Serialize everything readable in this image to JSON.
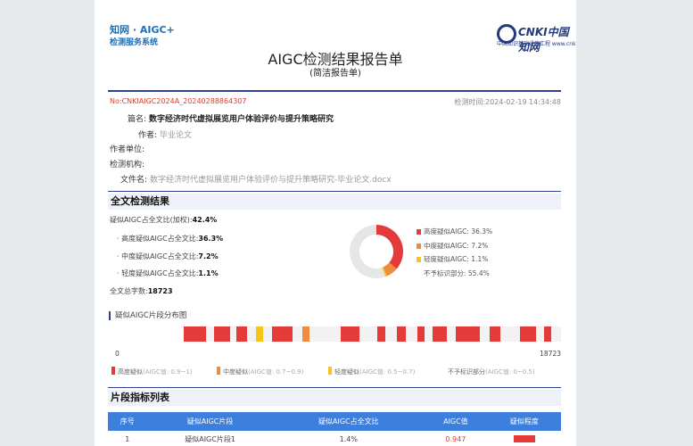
{
  "header": {
    "logo_line1": "知网 · AIGC+",
    "logo_line2": "检测服务系统",
    "cnki_name": "CNKI中国知网",
    "cnki_sub": "中国知识基础设施工程 www.cnki.net",
    "title": "AIGC检测结果报告单",
    "subtitle": "(简洁报告单)"
  },
  "report": {
    "no": "No:CNKIAIGC2024A_20240288864307",
    "time": "检测时间:2024-02-19 14:34:48"
  },
  "meta": [
    {
      "label": "篇名:",
      "value": "数字经济时代虚拟展览用户体验评价与提升策略研究",
      "style": "bold"
    },
    {
      "label": "作者:",
      "value": "毕业论文",
      "style": "grey"
    },
    {
      "label": "作者单位:",
      "value": "",
      "style": "grey"
    },
    {
      "label": "检测机构:",
      "value": "",
      "style": "grey"
    },
    {
      "label": "文件名:",
      "value": "数字经济时代虚拟展览用户体验评价与提升策略研究-毕业论文.docx",
      "style": "grey"
    }
  ],
  "section_full": "全文检测结果",
  "stats": {
    "weighted_label": "疑似AIGC占全文比(加权):",
    "weighted_value": "42.4%",
    "high_label": "· 高度疑似AIGC占全文比:",
    "high_value": "36.3%",
    "mid_label": "· 中度疑似AIGC占全文比:",
    "mid_value": "7.2%",
    "low_label": "· 轻度疑似AIGC占全文比:",
    "low_value": "1.1%",
    "total_label": "全文总字数:",
    "total_value": "18723"
  },
  "colors": {
    "high": "#e53a3a",
    "mid": "#f08a3c",
    "low": "#f5c518",
    "none": "#e6e6e6",
    "accent": "#2f3f94",
    "header_blue": "#3d7fdc"
  },
  "chart_data": {
    "type": "pie",
    "categories": [
      "高度疑似AIGC",
      "中度疑似AIGC",
      "轻度疑似AIGC",
      "不予标识部分"
    ],
    "values": [
      36.3,
      7.2,
      1.1,
      55.4
    ],
    "labels": [
      "高度疑似AIGC: 36.3%",
      "中度疑似AIGC: 7.2%",
      "轻度疑似AIGC: 1.1%",
      "不予标识部分: 55.4%"
    ]
  },
  "distribution": {
    "title": "疑似AIGC片段分布图",
    "start": "0",
    "end": "18723",
    "total": 18723,
    "segments": [
      {
        "start": 0,
        "end": 1100,
        "level": "high"
      },
      {
        "start": 1500,
        "end": 2300,
        "level": "high"
      },
      {
        "start": 2600,
        "end": 3150,
        "level": "high"
      },
      {
        "start": 3600,
        "end": 3950,
        "level": "low"
      },
      {
        "start": 4400,
        "end": 5400,
        "level": "high"
      },
      {
        "start": 5900,
        "end": 6250,
        "level": "mid"
      },
      {
        "start": 7800,
        "end": 8700,
        "level": "high"
      },
      {
        "start": 9600,
        "end": 10000,
        "level": "high"
      },
      {
        "start": 10600,
        "end": 11000,
        "level": "high"
      },
      {
        "start": 11600,
        "end": 11950,
        "level": "high"
      },
      {
        "start": 12350,
        "end": 13050,
        "level": "high"
      },
      {
        "start": 13500,
        "end": 14700,
        "level": "high"
      },
      {
        "start": 15200,
        "end": 15700,
        "level": "high"
      },
      {
        "start": 16700,
        "end": 17500,
        "level": "high"
      },
      {
        "start": 17900,
        "end": 18250,
        "level": "high"
      }
    ],
    "legend": [
      {
        "label": "高度疑似",
        "range": "(AIGC值: 0.9~1)",
        "level": "high"
      },
      {
        "label": "中度疑似",
        "range": "(AIGC值: 0.7~0.9)",
        "level": "mid"
      },
      {
        "label": "轻度疑似",
        "range": "(AIGC值: 0.5~0.7)",
        "level": "low"
      },
      {
        "label": "不予标识部分",
        "range": "(AIGC值: 0~0.5)",
        "level": "none"
      }
    ]
  },
  "section_table": "片段指标列表",
  "table": {
    "headers": [
      "序号",
      "疑似AIGC片段",
      "疑似AIGC占全文比",
      "AIGC值",
      "疑似程度"
    ],
    "rows": [
      {
        "index": "1",
        "segment": "疑似AIGC片段1",
        "ratio": "1.4%",
        "value": "0.947",
        "level": "high"
      }
    ]
  }
}
